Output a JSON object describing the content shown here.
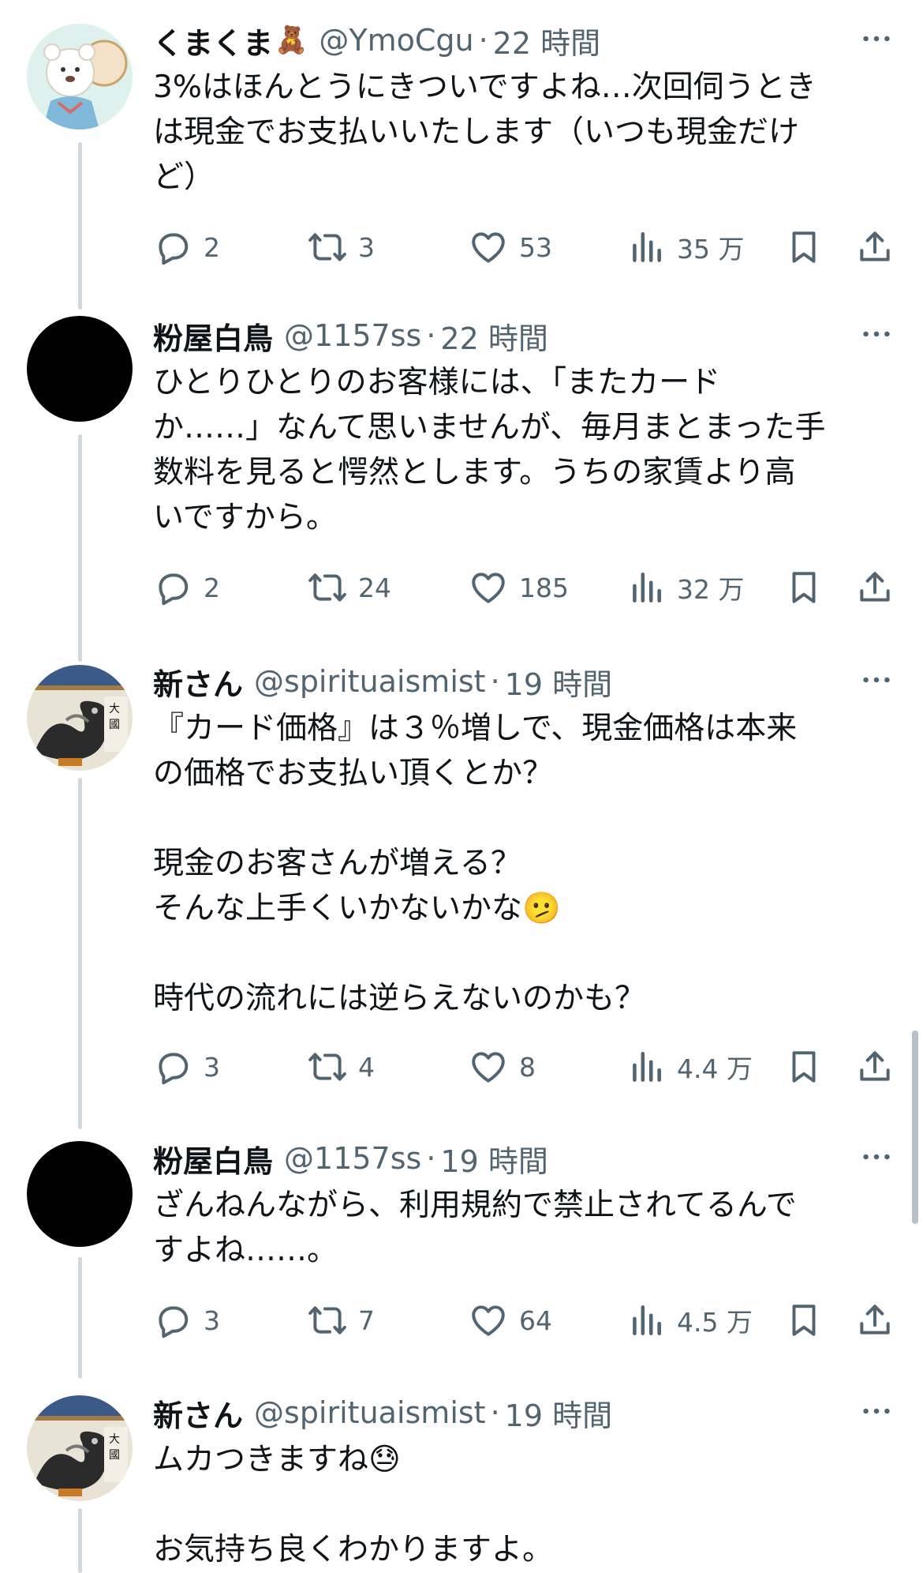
{
  "tweets": [
    {
      "name": "くまくま",
      "name_emoji": "🧸",
      "handle": "@YmoCgu",
      "time": "22 時間",
      "lines": [
        "3%はほんとうにきついですよね…次回伺うとき",
        "は現金でお支払いいたします（いつも現金だけ",
        "ど）"
      ],
      "replies": "2",
      "retweets": "3",
      "likes": "53",
      "views": "35 万"
    },
    {
      "name": "粉屋白鳥",
      "handle": "@1157ss",
      "time": "22 時間",
      "lines": [
        "ひとりひとりのお客様には、「またカード",
        "か……」なんて思いませんが、毎月まとまった手",
        "数料を見ると愕然とします。うちの家賃より高",
        "いですから。"
      ],
      "replies": "2",
      "retweets": "24",
      "likes": "185",
      "views": "32 万"
    },
    {
      "name": "新さん",
      "handle": "@spirituaismist",
      "time": "19 時間",
      "lines": [
        "『カード価格』は３％増しで、現金価格は本来",
        "の価格でお支払い頂くとか？",
        "",
        "現金のお客さんが増える？",
        "そんな上手くいかないかな",
        "",
        "時代の流れには逆らえないのかも？"
      ],
      "inline_emoji": "🫤",
      "replies": "3",
      "retweets": "4",
      "likes": "8",
      "views": "4.4 万"
    },
    {
      "name": "粉屋白鳥",
      "handle": "@1157ss",
      "time": "19 時間",
      "lines": [
        "ざんねんながら、利用規約で禁止されてるんで",
        "すよね……。"
      ],
      "replies": "3",
      "retweets": "7",
      "likes": "64",
      "views": "4.5 万"
    },
    {
      "name": "新さん",
      "handle": "@spirituaismist",
      "time": "19 時間",
      "lines": [
        "ムカつきますね",
        "",
        "お気持ち良くわかりますよ。"
      ],
      "inline_emoji": "😓"
    }
  ],
  "icons": {
    "reply": "reply-icon",
    "retweet": "retweet-icon",
    "like": "heart-icon",
    "views": "views-icon",
    "bookmark": "bookmark-icon",
    "share": "share-icon",
    "more": "more-icon"
  },
  "colors": {
    "text": "#0f1419",
    "secondary": "#536471",
    "thread_line": "#cfd9de"
  }
}
